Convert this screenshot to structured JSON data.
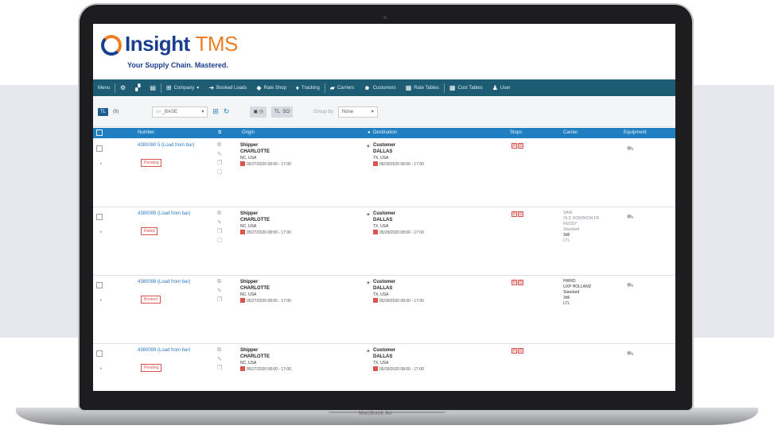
{
  "brand": {
    "name": "Insight",
    "suffix": "TMS",
    "tagline": "Your Supply Chain. Mastered."
  },
  "device": {
    "label": "MacBook Air"
  },
  "menu": {
    "items": [
      {
        "label": "Menu",
        "icon": "hamburger-icon"
      },
      {
        "label": "Company",
        "icon": "sitemap-icon"
      },
      {
        "label": "Booked Loads",
        "icon": "truck-icon"
      },
      {
        "label": "Rate Shop",
        "icon": "tag-icon"
      },
      {
        "label": "Tracking",
        "icon": "map-pin-icon"
      },
      {
        "label": "Carriers",
        "icon": "truck-icon"
      },
      {
        "label": "Customers",
        "icon": "users-icon"
      },
      {
        "label": "Rate Tables",
        "icon": "grid-icon"
      },
      {
        "label": "Cost Tables",
        "icon": "grid-icon"
      },
      {
        "label": "User",
        "icon": "user-icon"
      }
    ]
  },
  "toolbar": {
    "tl_label": "TL",
    "count": "(9)",
    "filter_value": "_BASE",
    "mode_a": "TL",
    "mode_b": "SO",
    "group_label": "Group by",
    "group_value": "None"
  },
  "table": {
    "columns": [
      "Number",
      "Origin",
      "Destination",
      "Stops",
      "Carrier",
      "Equipment"
    ],
    "rows": [
      {
        "number": "4380090 5 (Load from bar)",
        "status": "Pending",
        "origin": {
          "name": "Shipper",
          "city": "CHARLOTTE",
          "region": "NC, USA",
          "date": "05/27/2020 08:00 - 17:00"
        },
        "destination": {
          "name": "Customer",
          "city": "DALLAS",
          "region": "TX, USA",
          "date": "05/29/2020 08:00 - 17:00"
        },
        "carrier": [],
        "carrier_faded": false
      },
      {
        "number": "4380095 (Load from bar)",
        "status": "Rated",
        "origin": {
          "name": "Shipper",
          "city": "CHARLOTTE",
          "region": "NC, USA",
          "date": "05/27/2020 08:00 - 17:00"
        },
        "destination": {
          "name": "Customer",
          "city": "DALLAS",
          "region": "TX, USA",
          "date": "05/29/2020 08:00 - 17:00"
        },
        "carrier": [
          "SAIA",
          "OLD DOMINION FR",
          "REDDY",
          "Standard",
          "3d6",
          "LTL"
        ],
        "carrier_faded": true
      },
      {
        "number": "4380098 (Load from bar)",
        "status": "Booked",
        "origin": {
          "name": "Shipper",
          "city": "CHARLOTTE",
          "region": "NC, USA",
          "date": "05/27/2020 08:00 - 17:00"
        },
        "destination": {
          "name": "Customer",
          "city": "DALLAS",
          "region": "TX, USA",
          "date": "05/29/2020 08:00 - 17:00"
        },
        "carrier": [
          "HWRD",
          "UXP HOLLAND",
          "Standard",
          "3d6",
          "LTL"
        ],
        "carrier_faded": false
      },
      {
        "number": "4380099 (Load from bar)",
        "status": "Pending",
        "origin": {
          "name": "Shipper",
          "city": "CHARLOTTE",
          "region": "NC, USA",
          "date": "05/27/2020 08:00 - 17:00"
        },
        "destination": {
          "name": "Customer",
          "city": "DALLAS",
          "region": "TX, USA",
          "date": "05/29/2020 08:00 - 17:00"
        },
        "carrier": [],
        "carrier_faded": false
      }
    ]
  }
}
